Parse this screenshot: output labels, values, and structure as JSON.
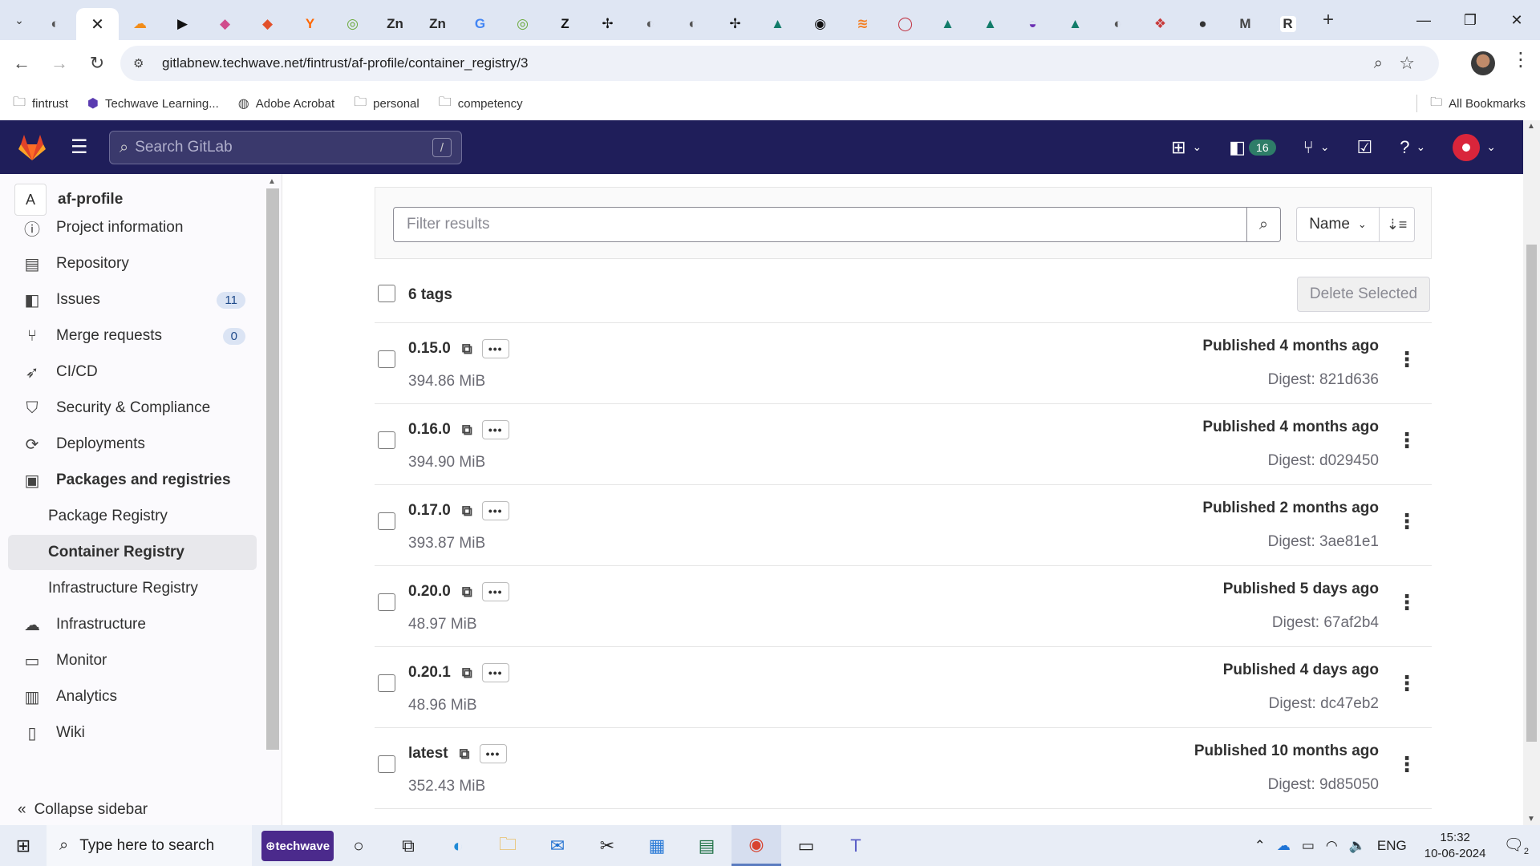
{
  "browser": {
    "tabs": [
      {
        "icon": "chrome-tab-icon",
        "color": "#555555",
        "glyph": "◐"
      },
      {
        "icon": "close-icon",
        "active": true,
        "glyph": "✕"
      },
      {
        "icon": "cloud-tab-icon",
        "color": "#f28c18",
        "glyph": "☁"
      },
      {
        "icon": "video-tab-icon",
        "color": "#111111",
        "glyph": "▶"
      },
      {
        "icon": "app-tab-icon",
        "color": "#d04c8c",
        "glyph": "◆"
      },
      {
        "icon": "shield-tab-icon",
        "color": "#e2502a",
        "glyph": "◆"
      },
      {
        "icon": "y-tab-icon",
        "color": "#ff6600",
        "glyph": "Y"
      },
      {
        "icon": "green-tab-icon",
        "color": "#6aa93a",
        "glyph": "◎"
      },
      {
        "icon": "zn-tab-icon",
        "color": "#2a2a2a",
        "glyph": "Zn"
      },
      {
        "icon": "zn-tab-icon",
        "color": "#2a2a2a",
        "glyph": "Zn"
      },
      {
        "icon": "google-tab-icon",
        "color": "#4285f4",
        "glyph": "G"
      },
      {
        "icon": "green-tab-icon",
        "color": "#6aa93a",
        "glyph": "◎"
      },
      {
        "icon": "zendesk-tab-icon",
        "color": "#111111",
        "glyph": "Z"
      },
      {
        "icon": "jira-tab-icon",
        "color": "#111111",
        "glyph": "✢"
      },
      {
        "icon": "chrome-tab-icon",
        "color": "#555555",
        "glyph": "◐"
      },
      {
        "icon": "chrome-tab-icon",
        "color": "#555555",
        "glyph": "◐"
      },
      {
        "icon": "jira-tab-icon",
        "color": "#111111",
        "glyph": "✢"
      },
      {
        "icon": "triangle-tab-icon",
        "color": "#127c6a",
        "glyph": "▲"
      },
      {
        "icon": "ring-tab-icon",
        "color": "#111111",
        "glyph": "◉"
      },
      {
        "icon": "stack-tab-icon",
        "color": "#f48024",
        "glyph": "≋"
      },
      {
        "icon": "circle-tab-icon",
        "color": "#c23b4a",
        "glyph": "◯"
      },
      {
        "icon": "triangle-tab-icon",
        "color": "#127c6a",
        "glyph": "▲"
      },
      {
        "icon": "triangle-tab-icon",
        "color": "#127c6a",
        "glyph": "▲"
      },
      {
        "icon": "purple-tab-icon",
        "color": "#6b2fb3",
        "glyph": "◒"
      },
      {
        "icon": "triangle-tab-icon",
        "color": "#127c6a",
        "glyph": "▲"
      },
      {
        "icon": "chrome-tab-icon",
        "color": "#555555",
        "glyph": "◐"
      },
      {
        "icon": "game-tab-icon",
        "color": "#c83b3b",
        "glyph": "❖"
      },
      {
        "icon": "avatar-tab-icon",
        "color": "#333333",
        "glyph": "●"
      },
      {
        "icon": "m-tab-icon",
        "color": "#444444",
        "glyph": "M"
      },
      {
        "icon": "r-tab-icon",
        "color": "#ffffff",
        "glyph": "R"
      }
    ],
    "url": "gitlabnew.techwave.net/fintrust/af-profile/container_registry/3",
    "bookmarks": [
      {
        "label": "fintrust",
        "icon": "folder-icon"
      },
      {
        "label": "Techwave Learning...",
        "icon": "techwave-icon"
      },
      {
        "label": "Adobe Acrobat",
        "icon": "acrobat-icon"
      },
      {
        "label": "personal",
        "icon": "folder-icon"
      },
      {
        "label": "competency",
        "icon": "folder-icon"
      }
    ],
    "all_bookmarks": "All Bookmarks"
  },
  "gitlab": {
    "search_placeholder": "Search GitLab",
    "search_shortcut": "/",
    "todo_count": "16"
  },
  "sidebar": {
    "project_initial": "A",
    "project_name": "af-profile",
    "items": [
      {
        "label": "Project information",
        "icon": "info-icon"
      },
      {
        "label": "Repository",
        "icon": "repository-icon"
      },
      {
        "label": "Issues",
        "icon": "issues-icon",
        "count": "11"
      },
      {
        "label": "Merge requests",
        "icon": "merge-request-icon",
        "count": "0"
      },
      {
        "label": "CI/CD",
        "icon": "rocket-icon"
      },
      {
        "label": "Security & Compliance",
        "icon": "shield-icon"
      },
      {
        "label": "Deployments",
        "icon": "deployments-icon"
      },
      {
        "label": "Packages and registries",
        "icon": "package-icon"
      },
      {
        "label": "Package Registry",
        "sub": true
      },
      {
        "label": "Container Registry",
        "sub": true,
        "active": true
      },
      {
        "label": "Infrastructure Registry",
        "sub": true
      },
      {
        "label": "Infrastructure",
        "icon": "cloud-gear-icon"
      },
      {
        "label": "Monitor",
        "icon": "monitor-icon"
      },
      {
        "label": "Analytics",
        "icon": "chart-icon"
      },
      {
        "label": "Wiki",
        "icon": "book-icon"
      }
    ],
    "collapse_label": "Collapse sidebar"
  },
  "main": {
    "filter_placeholder": "Filter results",
    "sort_label": "Name",
    "tags_count_label": "6 tags",
    "delete_selected": "Delete Selected",
    "tags": [
      {
        "name": "0.15.0",
        "size": "394.86 MiB",
        "published": "Published 4 months ago",
        "digest": "Digest: 821d636"
      },
      {
        "name": "0.16.0",
        "size": "394.90 MiB",
        "published": "Published 4 months ago",
        "digest": "Digest: d029450"
      },
      {
        "name": "0.17.0",
        "size": "393.87 MiB",
        "published": "Published 2 months ago",
        "digest": "Digest: 3ae81e1"
      },
      {
        "name": "0.20.0",
        "size": "48.97 MiB",
        "published": "Published 5 days ago",
        "digest": "Digest: 67af2b4"
      },
      {
        "name": "0.20.1",
        "size": "48.96 MiB",
        "published": "Published 4 days ago",
        "digest": "Digest: dc47eb2"
      },
      {
        "name": "latest",
        "size": "352.43 MiB",
        "published": "Published 10 months ago",
        "digest": "Digest: 9d85050"
      }
    ]
  },
  "taskbar": {
    "search_placeholder": "Type here to search",
    "techwave_label": "⊕techwave",
    "language": "ENG",
    "time": "15:32",
    "date": "10-06-2024",
    "notification_count": "2"
  }
}
